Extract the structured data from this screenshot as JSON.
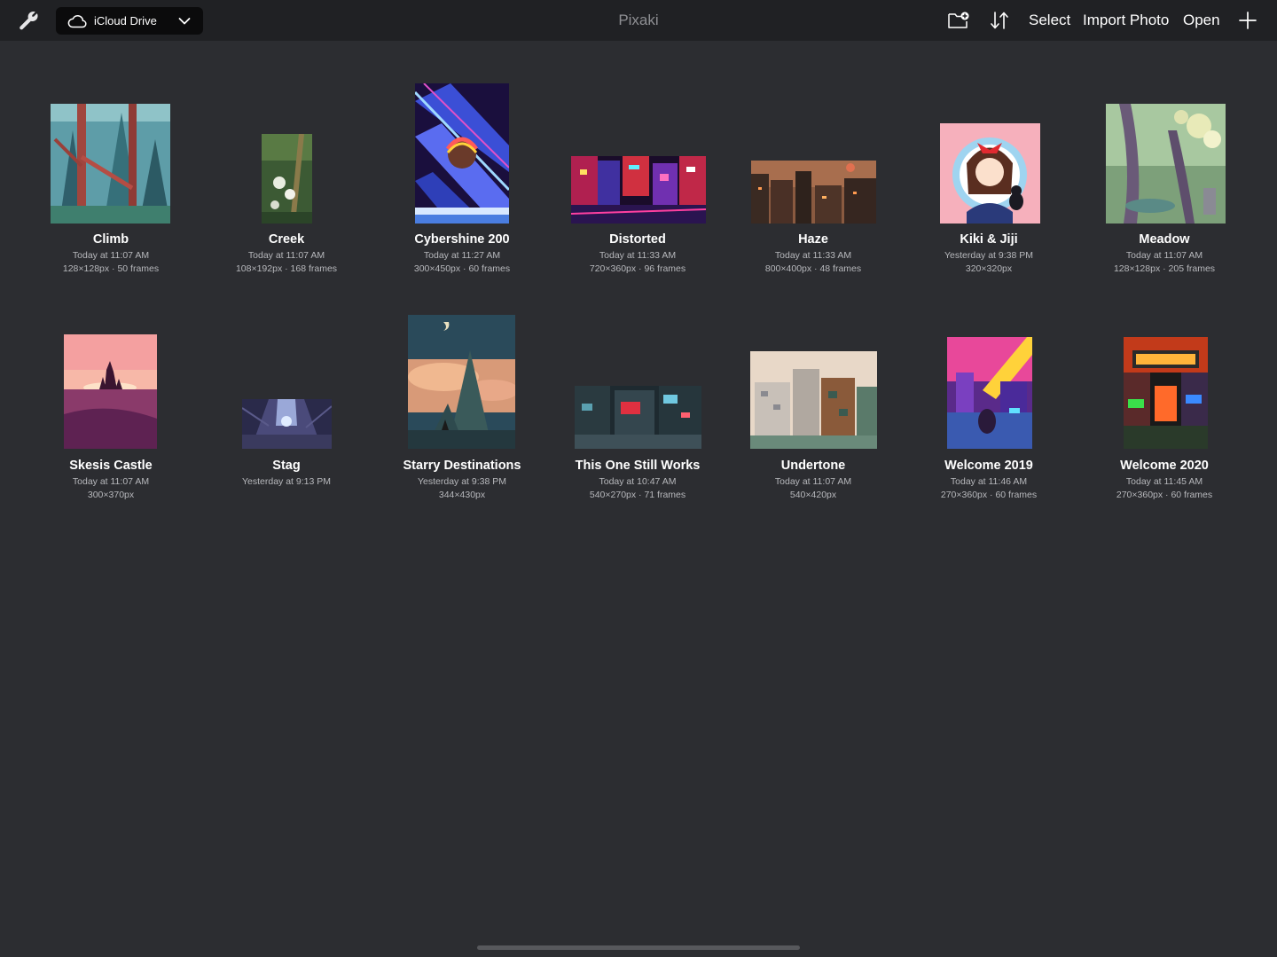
{
  "toolbar": {
    "settings_icon": "wrench-icon",
    "location_label": "iCloud Drive",
    "location_icon": "cloud-icon",
    "app_title": "Pixaki",
    "new_folder_icon": "folder-plus-icon",
    "sort_icon": "sort-arrows-icon",
    "select_label": "Select",
    "import_label": "Import Photo",
    "open_label": "Open",
    "add_icon": "plus-icon"
  },
  "documents": [
    {
      "name": "Climb",
      "date": "Today at 11:07 AM",
      "meta": "128×128px · 50 frames"
    },
    {
      "name": "Creek",
      "date": "Today at 11:07 AM",
      "meta": "108×192px · 168 frames"
    },
    {
      "name": "Cybershine 200",
      "date": "Today at 11:27 AM",
      "meta": "300×450px · 60 frames"
    },
    {
      "name": "Distorted",
      "date": "Today at 11:33 AM",
      "meta": "720×360px · 96 frames"
    },
    {
      "name": "Haze",
      "date": "Today at 11:33 AM",
      "meta": "800×400px · 48 frames"
    },
    {
      "name": "Kiki & Jiji",
      "date": "Yesterday at 9:38 PM",
      "meta": "320×320px"
    },
    {
      "name": "Meadow",
      "date": "Today at 11:07 AM",
      "meta": "128×128px · 205 frames"
    },
    {
      "name": "Skesis Castle",
      "date": "Today at 11:07 AM",
      "meta": "300×370px"
    },
    {
      "name": "Stag",
      "date": "Yesterday at 9:13 PM",
      "meta": ""
    },
    {
      "name": "Starry Destinations",
      "date": "Yesterday at 9:38 PM",
      "meta": "344×430px"
    },
    {
      "name": "This One Still Works",
      "date": "Today at 10:47 AM",
      "meta": "540×270px · 71 frames"
    },
    {
      "name": "Undertone",
      "date": "Today at 11:07 AM",
      "meta": "540×420px"
    },
    {
      "name": "Welcome 2019",
      "date": "Today at 11:46 AM",
      "meta": "270×360px · 60 frames"
    },
    {
      "name": "Welcome 2020",
      "date": "Today at 11:45 AM",
      "meta": "270×360px · 60 frames"
    }
  ],
  "colors": {
    "background": "#2c2d31",
    "toolbar": "#202124",
    "title_gray": "#8e8f93"
  }
}
